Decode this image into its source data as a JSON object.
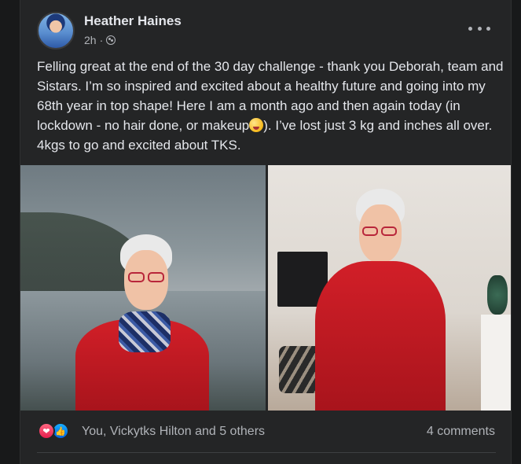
{
  "post": {
    "author": "Heather Haines",
    "timestamp": "2h",
    "separator": "·",
    "audience_icon": "globe-icon",
    "more_icon": "more-horizontal-icon",
    "text_parts": [
      "Felling great at the end of the 30 day challenge - thank you Deborah, team and Sistars.  I’m so inspired and excited about a healthy future and going into my 68th year in top shape!  Here I am a month ago and then again today (in lockdown - no hair done, or makeup",
      "). I’ve lost just 3 kg and inches all over.  4kgs to go and excited about TKS."
    ],
    "emoji": "grinning-face-emoji"
  },
  "photos": [
    {
      "name": "photo-before",
      "scene": "lake-mist"
    },
    {
      "name": "photo-after",
      "scene": "living-room"
    }
  ],
  "reactions": {
    "icons": [
      "heart-icon",
      "like-icon"
    ],
    "summary": "You, Vickytks Hilton and 5 others",
    "comments": "4 comments"
  },
  "colors": {
    "background": "#18191a",
    "card": "#242526",
    "text": "#e4e6eb",
    "secondary_text": "#b0b3b8",
    "heart": "#e61e4d",
    "like": "#0866ff"
  }
}
